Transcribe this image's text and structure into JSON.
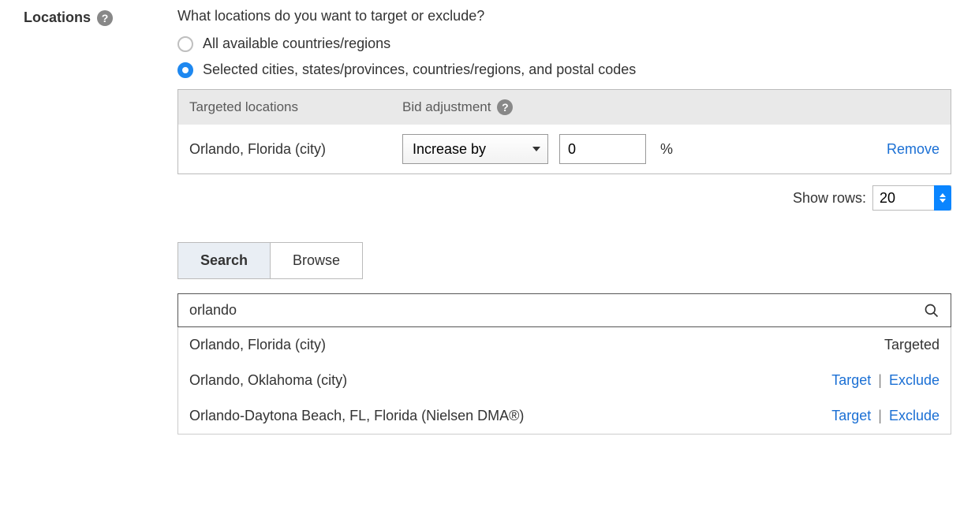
{
  "section_title": "Locations",
  "prompt": "What locations do you want to target or exclude?",
  "radio_all": "All available countries/regions",
  "radio_selected": "Selected cities, states/provinces, countries/regions, and postal codes",
  "table": {
    "col_loc": "Targeted locations",
    "col_bid": "Bid adjustment",
    "rows": [
      {
        "name": "Orlando, Florida (city)",
        "bid_mode": "Increase by",
        "bid_value": "0",
        "pct": "%",
        "remove": "Remove"
      }
    ]
  },
  "show_rows_label": "Show rows:",
  "show_rows_value": "20",
  "tabs": {
    "search": "Search",
    "browse": "Browse"
  },
  "search_value": "orlando",
  "results": [
    {
      "name": "Orlando, Florida (city)",
      "status": "Targeted"
    },
    {
      "name": "Orlando, Oklahoma (city)",
      "target": "Target",
      "exclude": "Exclude"
    },
    {
      "name": "Orlando-Daytona Beach, FL, Florida (Nielsen DMA®)",
      "target": "Target",
      "exclude": "Exclude"
    }
  ]
}
